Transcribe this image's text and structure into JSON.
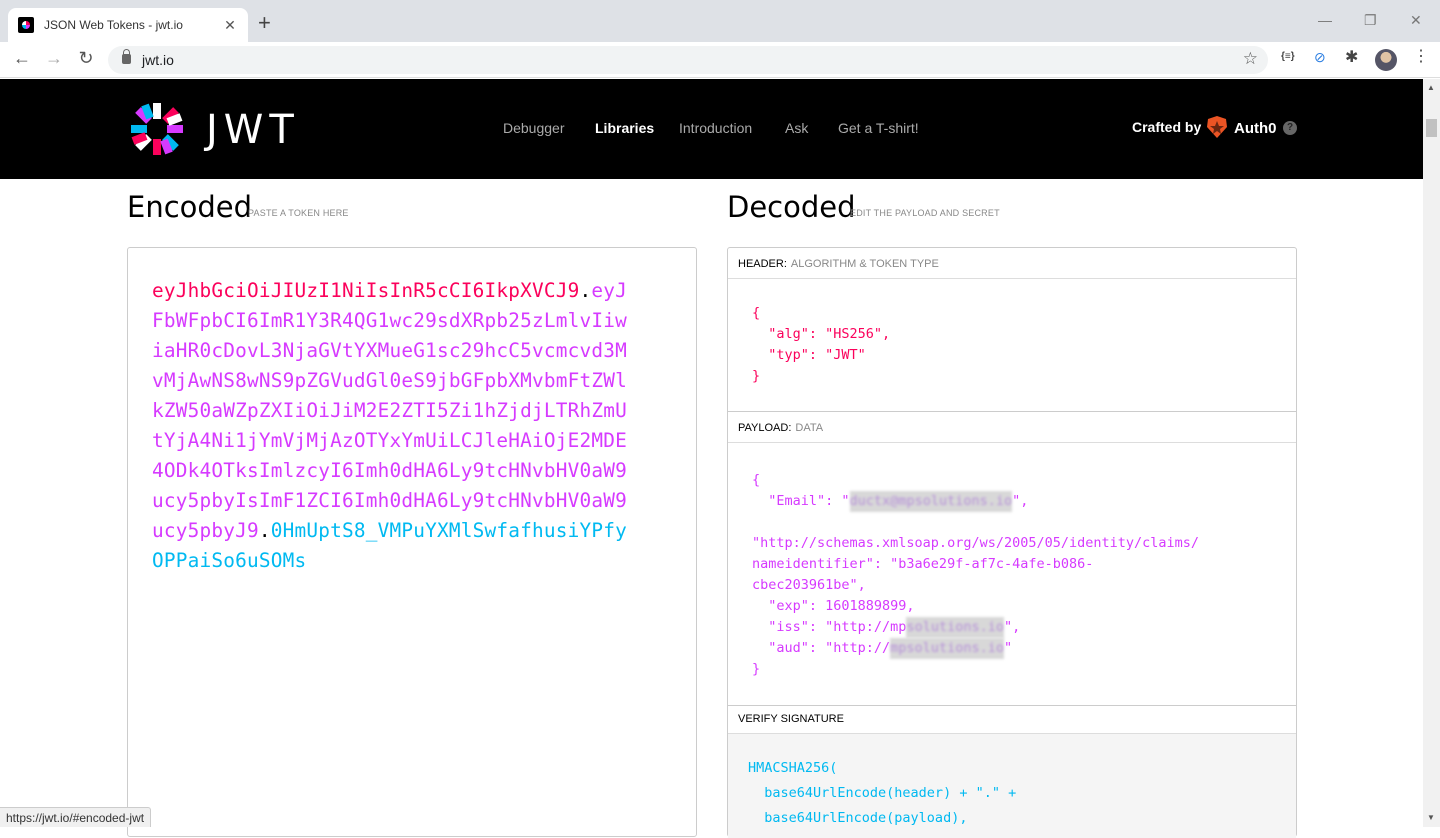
{
  "browser": {
    "tab_title": "JSON Web Tokens - jwt.io",
    "tab_close": "✕",
    "new_tab": "+",
    "url": "jwt.io",
    "minimize": "—",
    "restore": "❐",
    "close": "✕",
    "ext_json": "{≡}",
    "status_url": "https://jwt.io/#encoded-jwt"
  },
  "site": {
    "logo_text": "JWT",
    "nav": [
      "Debugger",
      "Libraries",
      "Introduction",
      "Ask",
      "Get a T-shirt!"
    ],
    "active_nav": "Libraries",
    "crafted_by": "Crafted by",
    "brand": "Auth0",
    "help": "?"
  },
  "encoded": {
    "title": "Encoded",
    "subtitle": "PASTE A TOKEN HERE",
    "token_header": "eyJhbGciOiJIUzI1NiIsInR5cCI6IkpXVCJ9",
    "token_payload_prefix": "eyJFbWFpbCI6ImR1Y3R4QG1wc29sdXRpb25zLmlvIiwiaHR0cDovL3NjaGVtYXMueG1sc29hcC5vcmcvd3MvMjAwNS8wNS9pZGVudGl0eS9jbGFpbXMvbmFtZWlkZW50aWZpZXIiOiJiM2E2ZTI5Zi1hZjdjLTRhZmUtYjA4Ni1jYmVjMjAzOTYxYmUiLCJleHAiOjE2MDE4ODk4OTksImlzcyI6Imh0dHA6Ly9tcHNvbHV0aW9ucy5pbyIsImF1ZCI6Imh0dHA6Ly9tcHNvbHV0aW9ucy5pbyJ9",
    "token_signature": "0HmUptS8_VMPuYXMlSwfafhusiYPfyOPPaiSo6uSOMs"
  },
  "decoded": {
    "title": "Decoded",
    "subtitle": "EDIT THE PAYLOAD AND SECRET",
    "header_label": "HEADER:",
    "header_desc": "ALGORITHM & TOKEN TYPE",
    "header_lines": [
      "{",
      "  \"alg\": \"HS256\",",
      "  \"typ\": \"JWT\"",
      "}"
    ],
    "payload_label": "PAYLOAD:",
    "payload_desc": "DATA",
    "payload_open": "{",
    "email_key": "  \"Email\": \"",
    "email_value": "ductx@mpsolutions.io",
    "email_end": "\",",
    "nameid_line1": "\"http://schemas.xmlsoap.org/ws/2005/05/identity/claims/",
    "nameid_line2": "nameidentifier\": \"b3a6e29f-af7c-4afe-b086-",
    "nameid_line3": "cbec203961be\",",
    "exp_line": "  \"exp\": 1601889899,",
    "iss_key": "  \"iss\": \"http://mp",
    "iss_blur": "solutions.io",
    "iss_end": "\",",
    "aud_key": "  \"aud\": \"http://",
    "aud_blur": "mpsolutions.io",
    "aud_end": "\"",
    "payload_close": "}",
    "verify_label": "VERIFY SIGNATURE",
    "verify_lines": [
      "HMACSHA256(",
      "  base64UrlEncode(header) + \".\" +",
      "  base64UrlEncode(payload),"
    ]
  }
}
